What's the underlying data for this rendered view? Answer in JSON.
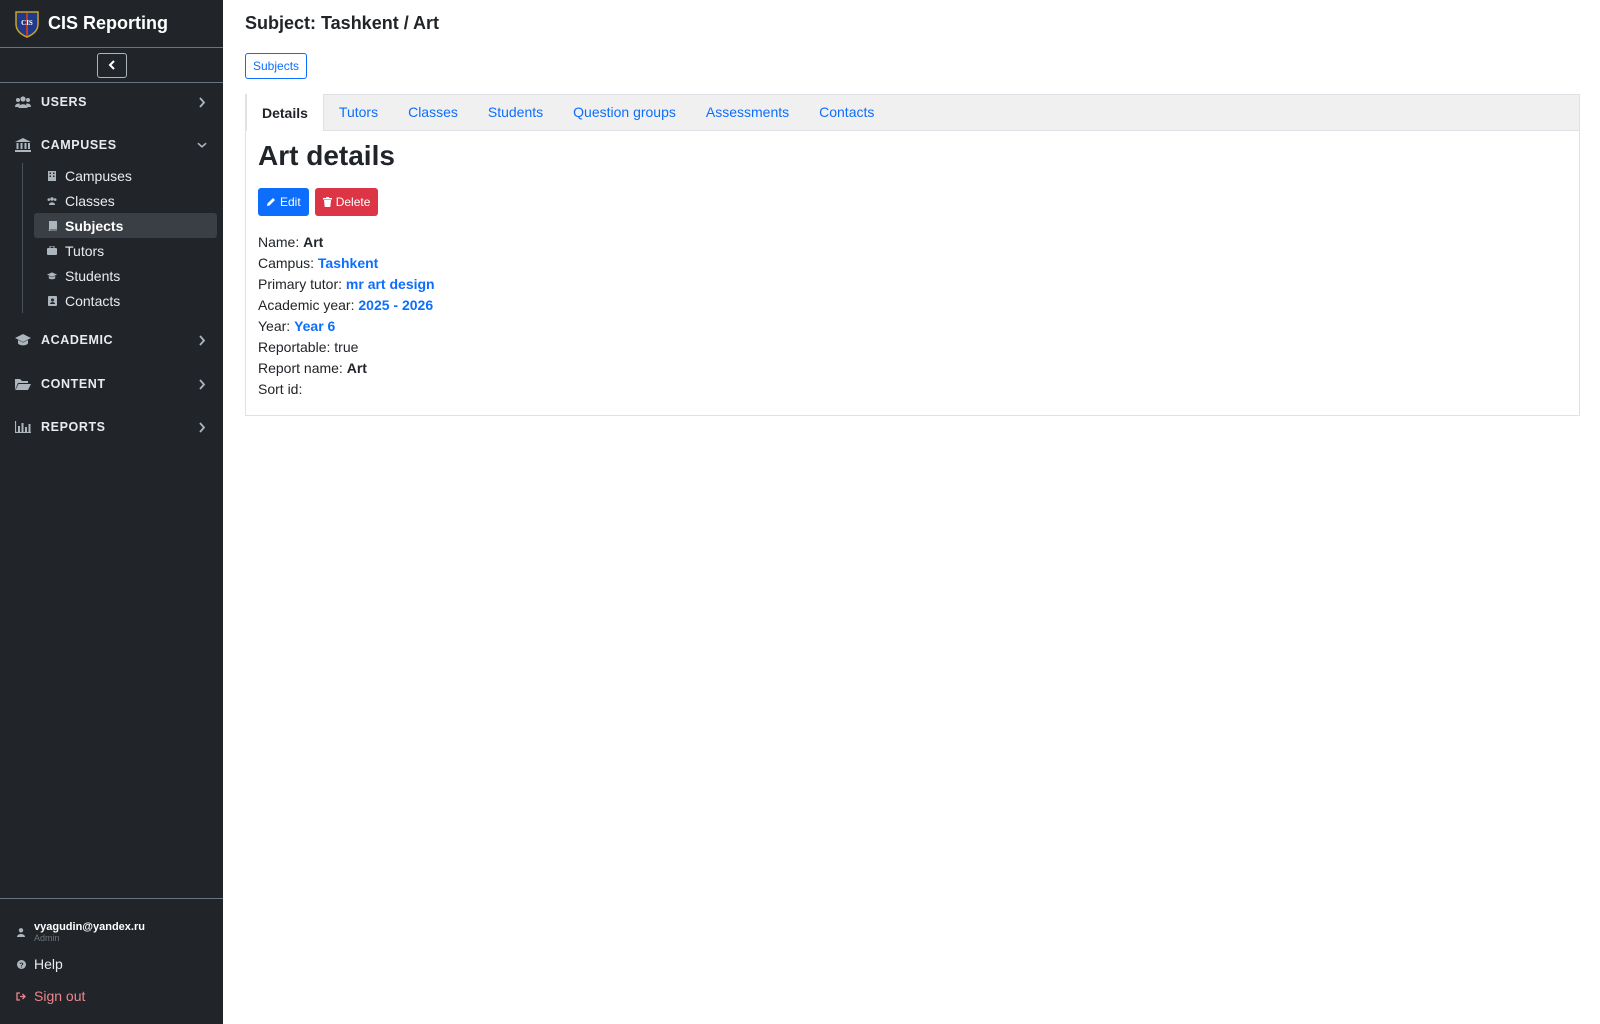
{
  "app": {
    "title": "CIS Reporting",
    "logo_text": "CIS"
  },
  "sidebar": {
    "sections": [
      {
        "label": "USERS",
        "icon": "users-icon",
        "expanded": false
      },
      {
        "label": "CAMPUSES",
        "icon": "building-columns-icon",
        "expanded": true
      },
      {
        "label": "ACADEMIC",
        "icon": "graduation-cap-icon",
        "expanded": false
      },
      {
        "label": "CONTENT",
        "icon": "folder-open-icon",
        "expanded": false
      },
      {
        "label": "REPORTS",
        "icon": "chart-bar-icon",
        "expanded": false
      }
    ],
    "campus_items": [
      {
        "label": "Campuses",
        "icon": "building-icon"
      },
      {
        "label": "Classes",
        "icon": "users-icon"
      },
      {
        "label": "Subjects",
        "icon": "book-icon",
        "active": true
      },
      {
        "label": "Tutors",
        "icon": "briefcase-icon"
      },
      {
        "label": "Students",
        "icon": "graduation-cap-icon"
      },
      {
        "label": "Contacts",
        "icon": "address-book-icon"
      }
    ],
    "footer": {
      "user_email": "vyagudin@yandex.ru",
      "user_role": "Admin",
      "help_label": "Help",
      "signout_label": "Sign out"
    }
  },
  "header": {
    "title": "Subject: Tashkent / Art",
    "breadcrumb_button": "Subjects"
  },
  "tabs": [
    "Details",
    "Tutors",
    "Classes",
    "Students",
    "Question groups",
    "Assessments",
    "Contacts"
  ],
  "details": {
    "heading": "Art details",
    "edit_label": "Edit",
    "delete_label": "Delete",
    "fields": [
      {
        "label": "Name:",
        "value": "Art",
        "type": "bold"
      },
      {
        "label": "Campus:",
        "value": "Tashkent",
        "type": "link"
      },
      {
        "label": "Primary tutor:",
        "value": "mr art design",
        "type": "link"
      },
      {
        "label": "Academic year:",
        "value": "2025 - 2026",
        "type": "link"
      },
      {
        "label": "Year:",
        "value": "Year 6",
        "type": "link"
      },
      {
        "label": "Reportable:",
        "value": "true",
        "type": "plain"
      },
      {
        "label": "Report name:",
        "value": "Art",
        "type": "bold"
      },
      {
        "label": "Sort id:",
        "value": "",
        "type": "plain"
      }
    ]
  },
  "colors": {
    "sidebar_bg": "#212529",
    "primary": "#0d6efd",
    "danger": "#dc3545",
    "signout": "#ea868f"
  }
}
